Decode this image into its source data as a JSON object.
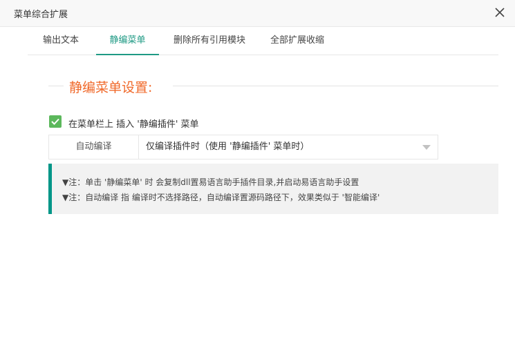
{
  "window": {
    "title": "菜单综合扩展",
    "close_icon": "close-icon"
  },
  "tabs": [
    {
      "label": "输出文本",
      "active": false
    },
    {
      "label": "静编菜单",
      "active": true
    },
    {
      "label": "删除所有引用模块",
      "active": false
    },
    {
      "label": "全部扩展收缩",
      "active": false
    }
  ],
  "section": {
    "title": "静编菜单设置:"
  },
  "checkbox": {
    "label": "在菜单栏上 插入 '静编插件' 菜单",
    "checked": true
  },
  "auto_compile": {
    "label": "自动编译",
    "selected": "仅编译插件时（使用 '静编插件' 菜单时）"
  },
  "notes": [
    "▼注：单击 '静编菜单' 时 会复制dll置易语言助手插件目录,并启动易语言助手设置",
    "▼注：自动编译 指 编译时不选择路径，自动编译置源码路径下，效果类似于 '智能编译'"
  ],
  "colors": {
    "accent": "#1f9a84",
    "section_title": "#f0692a",
    "checkbox": "#5cb85c",
    "note_border": "#009688"
  }
}
